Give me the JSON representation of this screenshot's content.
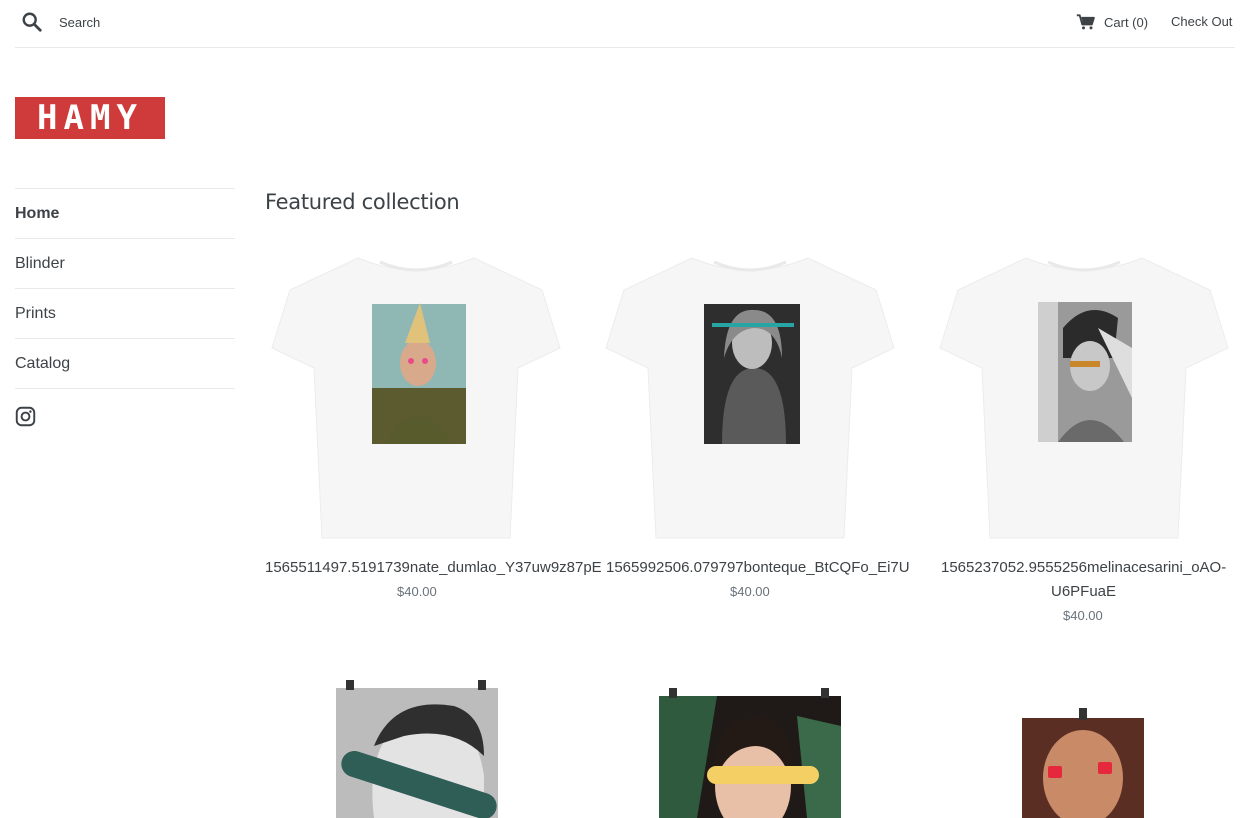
{
  "header": {
    "search_placeholder": "Search",
    "cart_label": "Cart (0)",
    "checkout_label": "Check Out"
  },
  "logo": {
    "text": "HAMY",
    "color": "#cf3a3a"
  },
  "nav": {
    "items": [
      {
        "label": "Home",
        "active": true
      },
      {
        "label": "Blinder",
        "active": false
      },
      {
        "label": "Prints",
        "active": false
      },
      {
        "label": "Catalog",
        "active": false
      }
    ]
  },
  "main": {
    "section_title": "Featured collection",
    "products": [
      {
        "title": "1565511497.5191739nate_dumlao_Y37uw9z87pE",
        "price": "$40.00"
      },
      {
        "title": "1565992506.079797bonteque_BtCQFo_Ei7U",
        "price": "$40.00"
      },
      {
        "title_line1": "1565237052.9555256melinacesarini_oAO-",
        "title_line2": "U6PFuaE",
        "price": "$40.00"
      }
    ]
  }
}
